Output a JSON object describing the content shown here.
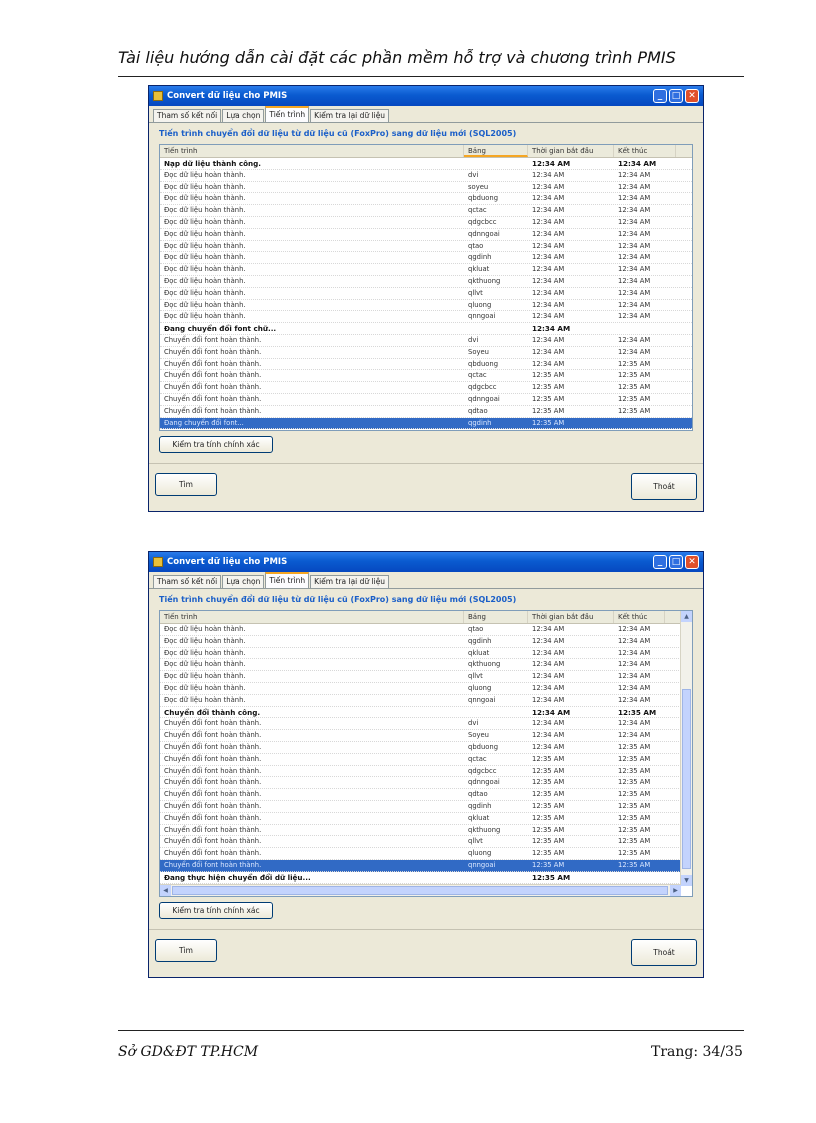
{
  "document": {
    "header": "Tài liệu hướng dẫn cài đặt các phần mềm hỗ trợ và chương trình PMIS",
    "footer_left": "Sở GD&ĐT TP.HCM",
    "footer_right": "Trang:  34/35"
  },
  "window1": {
    "title": "Convert dữ liệu cho PMIS",
    "tabs": [
      "Tham số kết nối",
      "Lựa chọn",
      "Tiến trình",
      "Kiểm tra lại dữ liệu"
    ],
    "heading": "Tiến trình chuyển đổi dữ liệu từ dữ liệu cũ (FoxPro) sang dữ liệu mới (SQL2005)",
    "columns": [
      "Tiến trình",
      "Bảng",
      "Thời gian bắt đầu",
      "Kết thúc"
    ],
    "rows": [
      {
        "task": "Nạp dữ liệu thành công.",
        "table": "",
        "start": "12:34 AM",
        "end": "12:34 AM",
        "bold": true
      },
      {
        "task": "Đọc dữ liệu hoàn thành.",
        "table": "dvi",
        "start": "12:34 AM",
        "end": "12:34 AM"
      },
      {
        "task": "Đọc dữ liệu hoàn thành.",
        "table": "soyeu",
        "start": "12:34 AM",
        "end": "12:34 AM"
      },
      {
        "task": "Đọc dữ liệu hoàn thành.",
        "table": "qbduong",
        "start": "12:34 AM",
        "end": "12:34 AM"
      },
      {
        "task": "Đọc dữ liệu hoàn thành.",
        "table": "qctac",
        "start": "12:34 AM",
        "end": "12:34 AM"
      },
      {
        "task": "Đọc dữ liệu hoàn thành.",
        "table": "qdgcbcc",
        "start": "12:34 AM",
        "end": "12:34 AM"
      },
      {
        "task": "Đọc dữ liệu hoàn thành.",
        "table": "qdnngoai",
        "start": "12:34 AM",
        "end": "12:34 AM"
      },
      {
        "task": "Đọc dữ liệu hoàn thành.",
        "table": "qtao",
        "start": "12:34 AM",
        "end": "12:34 AM"
      },
      {
        "task": "Đọc dữ liệu hoàn thành.",
        "table": "qgdinh",
        "start": "12:34 AM",
        "end": "12:34 AM"
      },
      {
        "task": "Đọc dữ liệu hoàn thành.",
        "table": "qkluat",
        "start": "12:34 AM",
        "end": "12:34 AM"
      },
      {
        "task": "Đọc dữ liệu hoàn thành.",
        "table": "qkthuong",
        "start": "12:34 AM",
        "end": "12:34 AM"
      },
      {
        "task": "Đọc dữ liệu hoàn thành.",
        "table": "qllvt",
        "start": "12:34 AM",
        "end": "12:34 AM"
      },
      {
        "task": "Đọc dữ liệu hoàn thành.",
        "table": "qluong",
        "start": "12:34 AM",
        "end": "12:34 AM"
      },
      {
        "task": "Đọc dữ liệu hoàn thành.",
        "table": "qnngoai",
        "start": "12:34 AM",
        "end": "12:34 AM"
      },
      {
        "task": "Đang chuyển đổi font chữ...",
        "table": "",
        "start": "12:34 AM",
        "end": "",
        "bold": true
      },
      {
        "task": "Chuyển đổi font hoàn thành.",
        "table": "dvi",
        "start": "12:34 AM",
        "end": "12:34 AM"
      },
      {
        "task": "Chuyển đổi font hoàn thành.",
        "table": "Soyeu",
        "start": "12:34 AM",
        "end": "12:34 AM"
      },
      {
        "task": "Chuyển đổi font hoàn thành.",
        "table": "qbduong",
        "start": "12:34 AM",
        "end": "12:35 AM"
      },
      {
        "task": "Chuyển đổi font hoàn thành.",
        "table": "qctac",
        "start": "12:35 AM",
        "end": "12:35 AM"
      },
      {
        "task": "Chuyển đổi font hoàn thành.",
        "table": "qdgcbcc",
        "start": "12:35 AM",
        "end": "12:35 AM"
      },
      {
        "task": "Chuyển đổi font hoàn thành.",
        "table": "qdnngoai",
        "start": "12:35 AM",
        "end": "12:35 AM"
      },
      {
        "task": "Chuyển đổi font hoàn thành.",
        "table": "qdtao",
        "start": "12:35 AM",
        "end": "12:35 AM"
      },
      {
        "task": "Đang chuyển đổi font...",
        "table": "qgdinh",
        "start": "12:35 AM",
        "end": "",
        "selected": true
      }
    ],
    "check_button": "Kiểm tra tính chính xác",
    "find_button": "Tìm",
    "exit_button": "Thoát"
  },
  "window2": {
    "title": "Convert dữ liệu cho PMIS",
    "tabs": [
      "Tham số kết nối",
      "Lựa chọn",
      "Tiến trình",
      "Kiểm tra lại dữ liệu"
    ],
    "heading": "Tiến trình chuyển đổi dữ liệu từ dữ liệu cũ (FoxPro) sang dữ liệu mới (SQL2005)",
    "columns": [
      "Tiến trình",
      "Bảng",
      "Thời gian bắt đầu",
      "Kết thúc"
    ],
    "rows": [
      {
        "task": "Đọc dữ liệu hoàn thành.",
        "table": "qtao",
        "start": "12:34 AM",
        "end": "12:34 AM"
      },
      {
        "task": "Đọc dữ liệu hoàn thành.",
        "table": "qgdinh",
        "start": "12:34 AM",
        "end": "12:34 AM"
      },
      {
        "task": "Đọc dữ liệu hoàn thành.",
        "table": "qkluat",
        "start": "12:34 AM",
        "end": "12:34 AM"
      },
      {
        "task": "Đọc dữ liệu hoàn thành.",
        "table": "qkthuong",
        "start": "12:34 AM",
        "end": "12:34 AM"
      },
      {
        "task": "Đọc dữ liệu hoàn thành.",
        "table": "qllvt",
        "start": "12:34 AM",
        "end": "12:34 AM"
      },
      {
        "task": "Đọc dữ liệu hoàn thành.",
        "table": "qluong",
        "start": "12:34 AM",
        "end": "12:34 AM"
      },
      {
        "task": "Đọc dữ liệu hoàn thành.",
        "table": "qnngoai",
        "start": "12:34 AM",
        "end": "12:34 AM"
      },
      {
        "task": "Chuyển đổi thành công.",
        "table": "",
        "start": "12:34 AM",
        "end": "12:35 AM",
        "bold": true
      },
      {
        "task": "Chuyển đổi font hoàn thành.",
        "table": "dvi",
        "start": "12:34 AM",
        "end": "12:34 AM"
      },
      {
        "task": "Chuyển đổi font hoàn thành.",
        "table": "Soyeu",
        "start": "12:34 AM",
        "end": "12:34 AM"
      },
      {
        "task": "Chuyển đổi font hoàn thành.",
        "table": "qbduong",
        "start": "12:34 AM",
        "end": "12:35 AM"
      },
      {
        "task": "Chuyển đổi font hoàn thành.",
        "table": "qctac",
        "start": "12:35 AM",
        "end": "12:35 AM"
      },
      {
        "task": "Chuyển đổi font hoàn thành.",
        "table": "qdgcbcc",
        "start": "12:35 AM",
        "end": "12:35 AM"
      },
      {
        "task": "Chuyển đổi font hoàn thành.",
        "table": "qdnngoai",
        "start": "12:35 AM",
        "end": "12:35 AM"
      },
      {
        "task": "Chuyển đổi font hoàn thành.",
        "table": "qdtao",
        "start": "12:35 AM",
        "end": "12:35 AM"
      },
      {
        "task": "Chuyển đổi font hoàn thành.",
        "table": "qgdinh",
        "start": "12:35 AM",
        "end": "12:35 AM"
      },
      {
        "task": "Chuyển đổi font hoàn thành.",
        "table": "qkluat",
        "start": "12:35 AM",
        "end": "12:35 AM"
      },
      {
        "task": "Chuyển đổi font hoàn thành.",
        "table": "qkthuong",
        "start": "12:35 AM",
        "end": "12:35 AM"
      },
      {
        "task": "Chuyển đổi font hoàn thành.",
        "table": "qllvt",
        "start": "12:35 AM",
        "end": "12:35 AM"
      },
      {
        "task": "Chuyển đổi font hoàn thành.",
        "table": "qluong",
        "start": "12:35 AM",
        "end": "12:35 AM"
      },
      {
        "task": "Chuyển đổi font hoàn thành.",
        "table": "qnngoai",
        "start": "12:35 AM",
        "end": "12:35 AM",
        "selected": true
      },
      {
        "task": "Đang thực hiện chuyển đổi dữ liệu...",
        "table": "",
        "start": "12:35 AM",
        "end": "",
        "bold": true
      }
    ],
    "check_button": "Kiểm tra tính chính xác",
    "find_button": "Tìm",
    "exit_button": "Thoát"
  }
}
